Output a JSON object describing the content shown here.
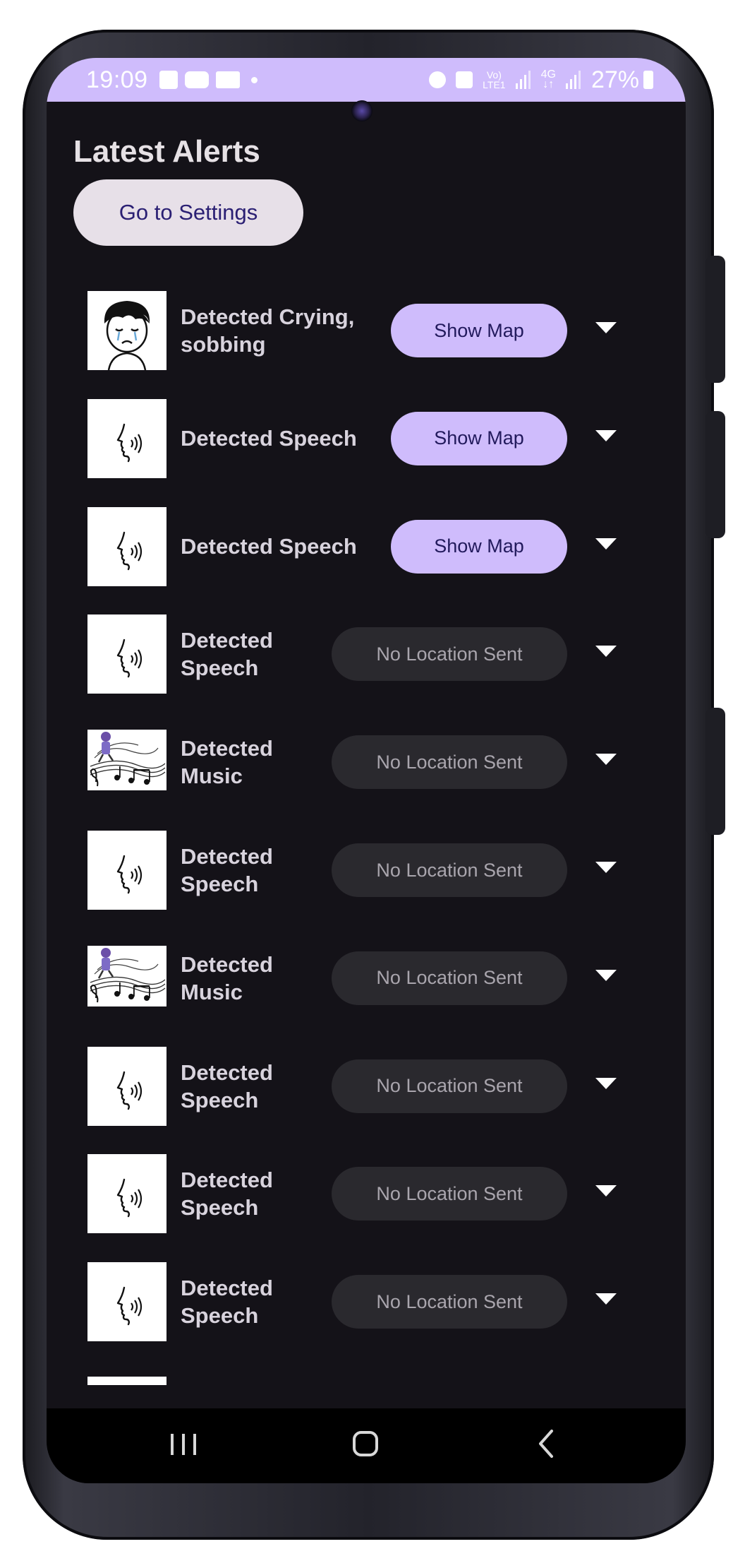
{
  "colors": {
    "screen_bg": "#141218",
    "accent": "#cfbcfc",
    "settings_button_bg": "#e7e0e8",
    "disabled_button_bg": "#2a292e"
  },
  "status_bar": {
    "time": "19:09",
    "battery": "27%",
    "left_icons": [
      "image-icon",
      "youtube-icon",
      "video-icon",
      "dot-icon"
    ],
    "right_icons": [
      "alarm-icon",
      "mute-icon",
      "volte-icon",
      "signal-icon",
      "4g-icon",
      "signal-icon",
      "battery-icon"
    ]
  },
  "page": {
    "title": "Latest Alerts",
    "settings_button": "Go to Settings"
  },
  "alerts": [
    {
      "lines": [
        "Detected Crying,",
        "sobbing"
      ],
      "icon": "crying-icon",
      "action": "Show Map",
      "has_location": true
    },
    {
      "lines": [
        "Detected Speech"
      ],
      "icon": "speech-icon",
      "action": "Show Map",
      "has_location": true
    },
    {
      "lines": [
        "Detected Speech"
      ],
      "icon": "speech-icon",
      "action": "Show Map",
      "has_location": true
    },
    {
      "lines": [
        "Detected",
        "Speech"
      ],
      "icon": "speech-icon",
      "action": "No Location Sent",
      "has_location": false
    },
    {
      "lines": [
        "Detected",
        "Music"
      ],
      "icon": "music-icon",
      "action": "No Location Sent",
      "has_location": false
    },
    {
      "lines": [
        "Detected",
        "Speech"
      ],
      "icon": "speech-icon",
      "action": "No Location Sent",
      "has_location": false
    },
    {
      "lines": [
        "Detected",
        "Music"
      ],
      "icon": "music-icon",
      "action": "No Location Sent",
      "has_location": false
    },
    {
      "lines": [
        "Detected",
        "Speech"
      ],
      "icon": "speech-icon",
      "action": "No Location Sent",
      "has_location": false
    },
    {
      "lines": [
        "Detected",
        "Speech"
      ],
      "icon": "speech-icon",
      "action": "No Location Sent",
      "has_location": false
    },
    {
      "lines": [
        "Detected",
        "Speech"
      ],
      "icon": "speech-icon",
      "action": "No Location Sent",
      "has_location": false
    }
  ],
  "nav": {
    "items": [
      "recent-apps-icon",
      "home-icon",
      "back-icon"
    ]
  }
}
